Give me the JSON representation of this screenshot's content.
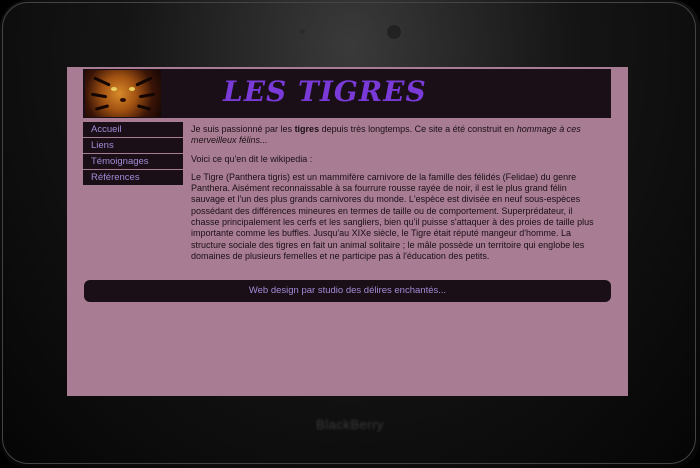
{
  "device": {
    "brand": "BlackBerry"
  },
  "header": {
    "title": "LES TIGRES",
    "logo_icon": "tiger-face-icon"
  },
  "nav": {
    "items": [
      {
        "label": "Accueil"
      },
      {
        "label": "Liens"
      },
      {
        "label": "Témoignages"
      },
      {
        "label": "Références"
      }
    ]
  },
  "content": {
    "intro_a": "Je suis passionné par les ",
    "intro_bold": "tigres",
    "intro_b": " depuis très longtemps. Ce site a été construit en ",
    "intro_italic": "hommage à ces merveilleux félins...",
    "wiki_lead": "Voici ce qu'en dit le wikipedia :",
    "quote": "Le Tigre (Panthera tigris) est un mammifère carnivore de la famille des félidés (Felidae) du genre Panthera. Aisément reconnaissable à sa fourrure rousse rayée de noir, il est le plus grand félin sauvage et l'un des plus grands carnivores du monde. L'espèce est divisée en neuf sous-espèces possédant des différences mineures en termes de taille ou de comportement. Superprédateur, il chasse principalement les cerfs et les sangliers, bien qu'il puisse s'attaquer à des proies de taille plus importante comme les buffles. Jusqu'au XIXe siècle, le Tigre était réputé mangeur d'homme. La structure sociale des tigres en fait un animal solitaire ; le mâle possède un territoire qui englobe les domaines de plusieurs femelles et ne participe pas à l'éducation des petits."
  },
  "footer": {
    "text": "Web design par studio des délires enchantés..."
  },
  "colors": {
    "page_bg": "#a87d93",
    "panel_bg": "#1a0f16",
    "title": "#7a3ad8",
    "link": "#a58ad8"
  }
}
